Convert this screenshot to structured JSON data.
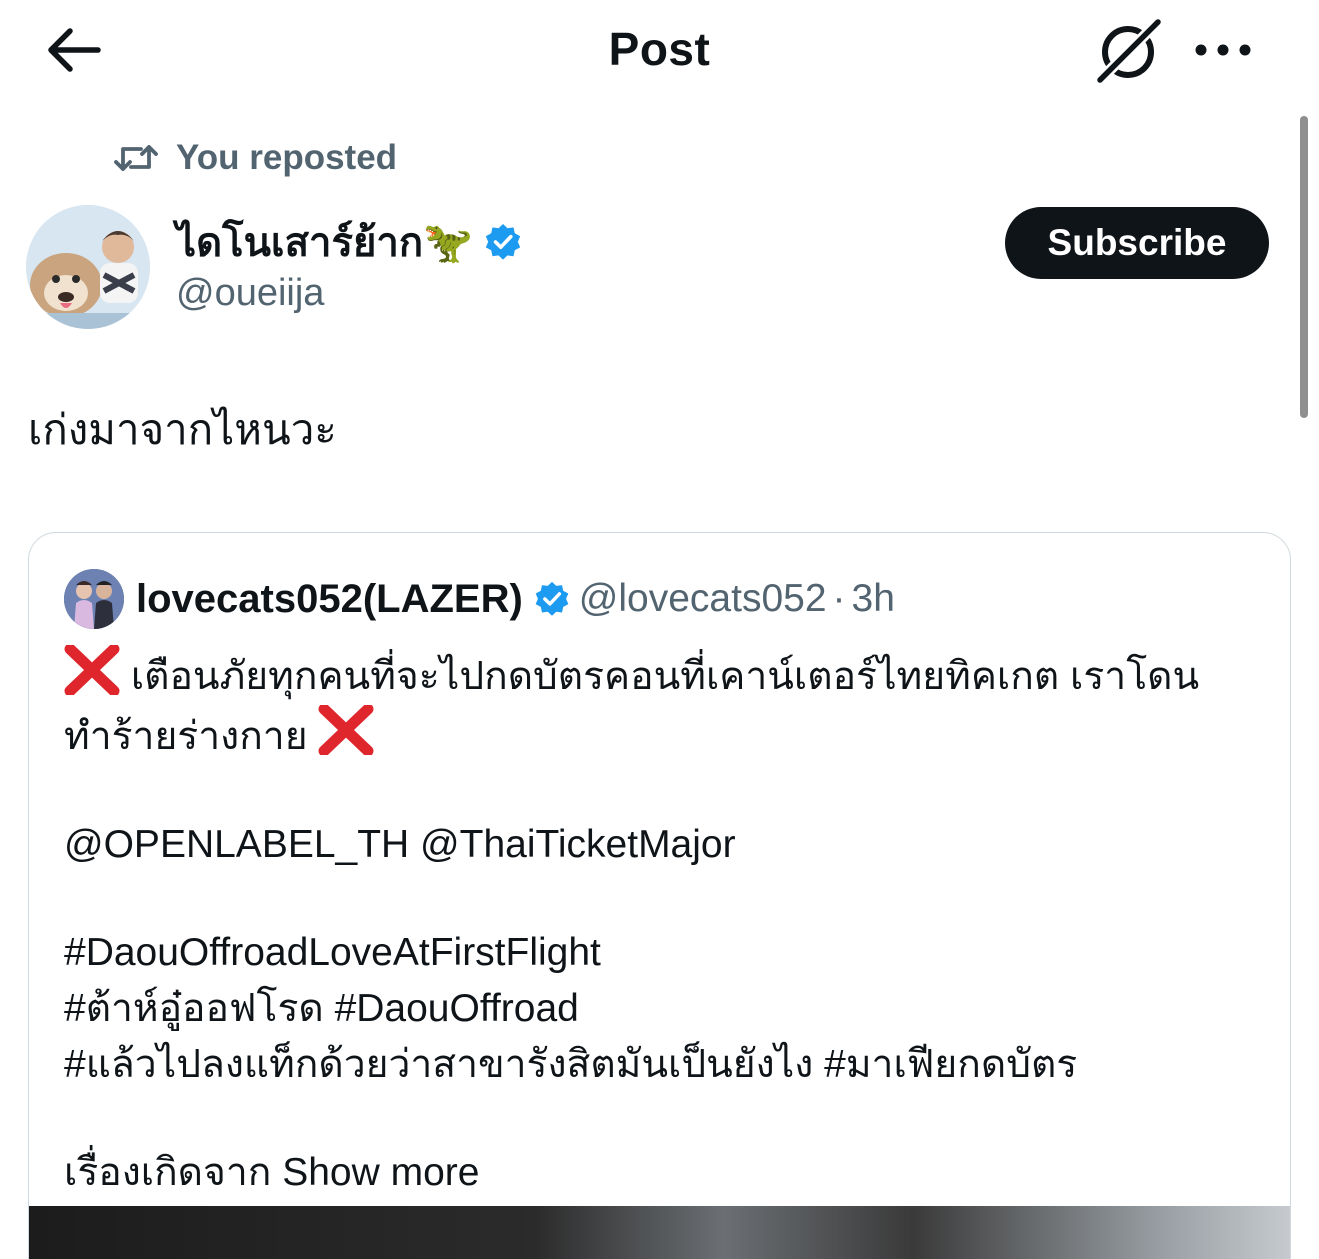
{
  "nav": {
    "title": "Post"
  },
  "repost": {
    "label": "You reposted"
  },
  "author": {
    "display_name": "ไดโนเสาร์ย้าก🦖",
    "handle": "@oueiija",
    "verified": true,
    "subscribe_label": "Subscribe"
  },
  "post": {
    "text": "เก่งมาจากไหนวะ"
  },
  "quote": {
    "display_name": "lovecats052(LAZER)",
    "verified": true,
    "handle": "@lovecats052",
    "separator": "·",
    "time": "3h",
    "line1": "เตือนภัยทุกคนที่จะไปกดบัตรคอนที่เคาน์เตอร์ไทยทิคเกต เราโดน",
    "line2": "ทำร้ายร่างกาย",
    "mentions": "@OPENLABEL_TH @ThaiTicketMajor",
    "hashtags1": "#DaouOffroadLoveAtFirstFlight",
    "hashtags2": "#ต้าห์อู๋ออฟโรด #DaouOffroad",
    "hashtags3": "#แล้วไปลงแท็กด้วยว่าสาขารังสิตมันเป็นยังไง  #มาเฟียกดบัตร",
    "tail_text": "เรื่องเกิดจาก",
    "show_more": "Show more"
  },
  "icons": {
    "back": "arrow-left-icon",
    "grok": "grok-icon",
    "more": "more-horizontal-icon",
    "repost": "repost-icon",
    "verified": "verified-badge-icon",
    "cross": "cross-mark-icon"
  },
  "colors": {
    "text_primary": "#0f1419",
    "text_secondary": "#536471",
    "verified_blue": "#1d9bf0",
    "button_dark": "#0f1419",
    "cross_red": "#e0262d",
    "card_border": "#cfd9de"
  }
}
